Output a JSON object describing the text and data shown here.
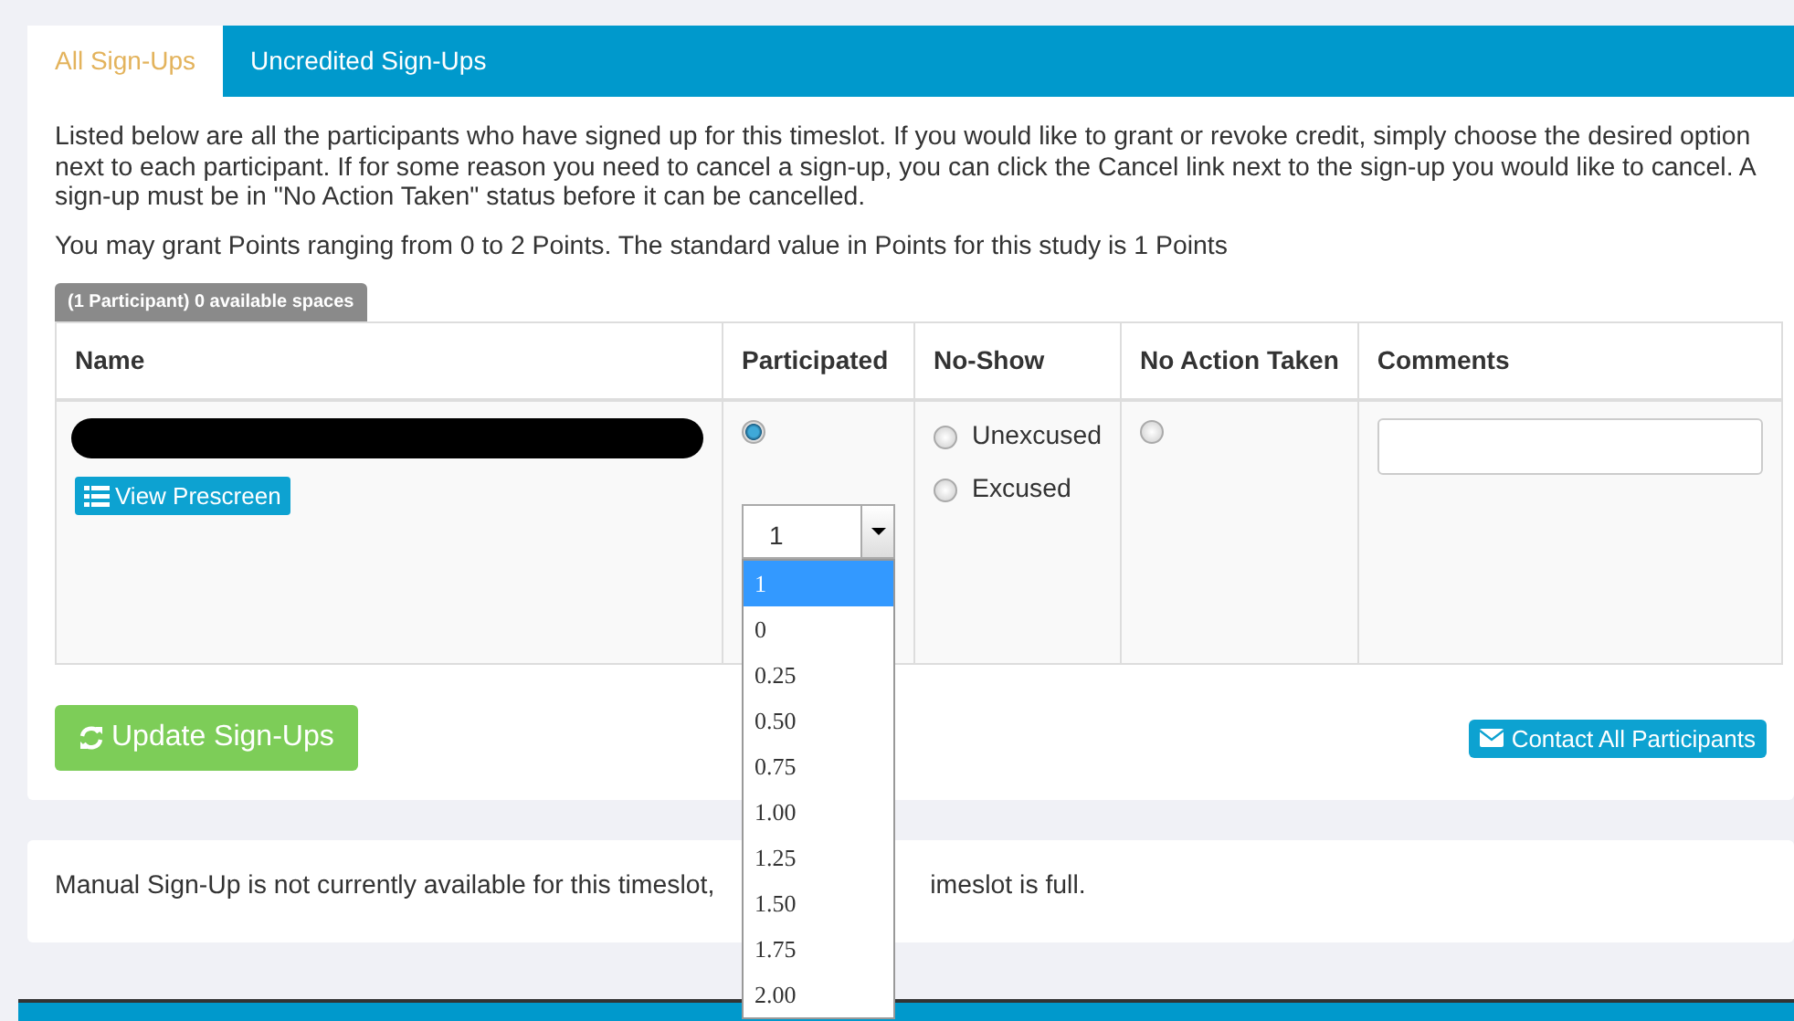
{
  "tabs": [
    {
      "label": "All Sign-Ups",
      "selected": true
    },
    {
      "label": "Uncredited Sign-Ups",
      "selected": false
    }
  ],
  "intro": "Listed below are all the participants who have signed up for this timeslot. If you would like to grant or revoke credit, simply choose the desired option next to each participant. If for some reason you need to cancel a sign-up, you can click the Cancel link next to the sign-up you would like to cancel. A sign-up must be in \"No Action Taken\" status before it can be cancelled.",
  "points_note": "You may grant Points ranging from 0 to 2 Points. The standard value in Points for this study is 1 Points",
  "count_badge": "(1 Participant) 0 available spaces",
  "table": {
    "columns": [
      "Name",
      "Participated",
      "No-Show",
      "No Action Taken",
      "Comments"
    ],
    "rows": [
      {
        "name_redacted": true,
        "prescreen_button": "View Prescreen",
        "participated": {
          "selected": true
        },
        "points": {
          "value": "1",
          "expanded": true,
          "options": [
            {
              "label": "1",
              "selected": true
            },
            {
              "label": "0",
              "selected": false
            },
            {
              "label": "0.25",
              "selected": false
            },
            {
              "label": "0.50",
              "selected": false
            },
            {
              "label": "0.75",
              "selected": false
            },
            {
              "label": "1.00",
              "selected": false
            },
            {
              "label": "1.25",
              "selected": false
            },
            {
              "label": "1.50",
              "selected": false
            },
            {
              "label": "1.75",
              "selected": false
            },
            {
              "label": "2.00",
              "selected": false
            }
          ]
        },
        "no_show": [
          {
            "label": "Unexcused",
            "selected": false
          },
          {
            "label": "Excused",
            "selected": false
          }
        ],
        "no_action": {
          "selected": false
        }
      }
    ]
  },
  "update_button": "Update Sign-Ups",
  "contact_button": "Contact All Participants",
  "manual_notice": [
    "Manual Sign-Up is not currently available for this timeslot,",
    "imeslot is full."
  ]
}
